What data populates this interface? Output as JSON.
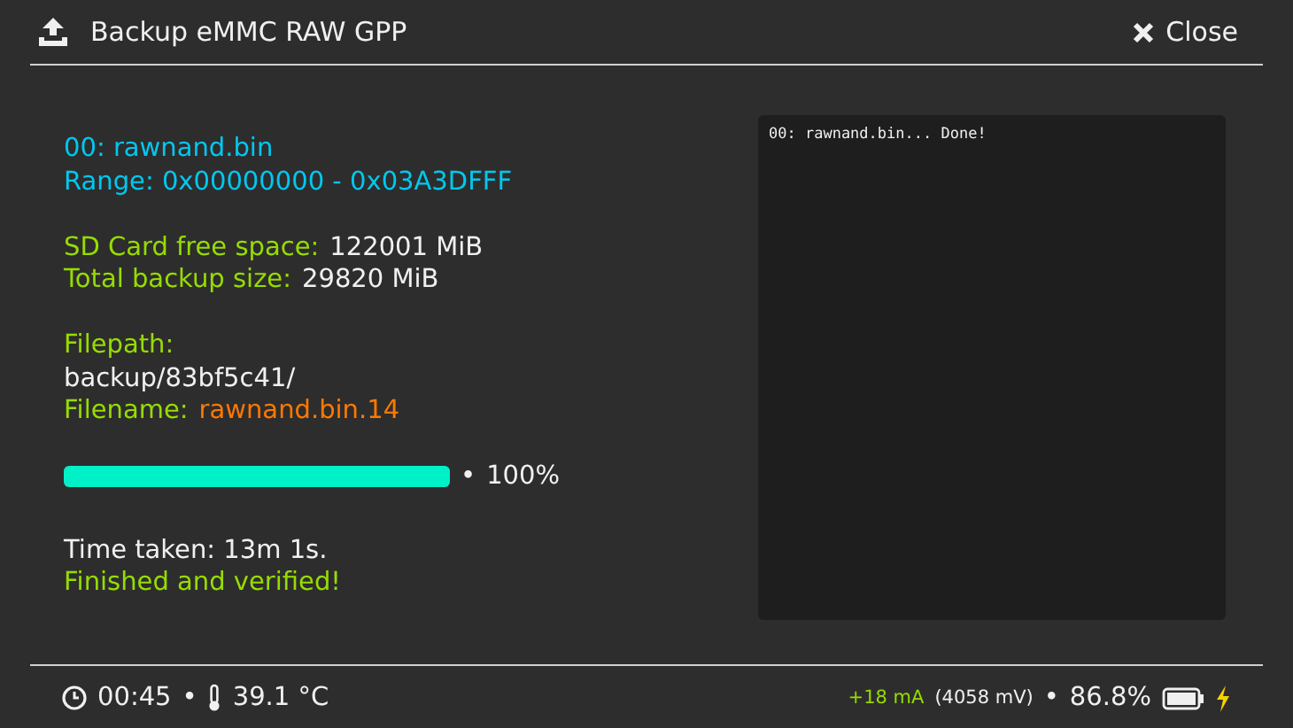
{
  "header": {
    "title": "Backup eMMC RAW GPP",
    "close_label": "Close"
  },
  "info_groups": [
    [
      {
        "parts": [
          {
            "text": "00: rawnand.bin",
            "color": "#00c8ef"
          }
        ]
      },
      {
        "parts": [
          {
            "text": "Range: 0x00000000 - 0x03A3DFFF",
            "color": "#00c8ef"
          }
        ]
      }
    ],
    [
      {
        "parts": [
          {
            "text": "SD Card free space:",
            "color": "#96dc00"
          },
          {
            "text": "122001 MiB",
            "color": "#f0f0f0"
          }
        ]
      },
      {
        "parts": [
          {
            "text": "Total backup size:",
            "color": "#96dc00"
          },
          {
            "text": "29820 MiB",
            "color": "#f0f0f0"
          }
        ]
      }
    ],
    [
      {
        "parts": [
          {
            "text": "Filepath:",
            "color": "#96dc00"
          }
        ]
      },
      {
        "parts": [
          {
            "text": "backup/83bf5c41/",
            "color": "#f0f0f0"
          }
        ]
      },
      {
        "parts": [
          {
            "text": "Filename:",
            "color": "#96dc00"
          },
          {
            "text": "rawnand.bin.14",
            "color": "#ff7800"
          }
        ]
      }
    ]
  ],
  "progress": {
    "level": 1,
    "separator": "•",
    "reading": "100%"
  },
  "result_lines": [
    {
      "text": "Time taken: 13m 1s.",
      "color": "#f0f0f0"
    },
    {
      "text": "Finished and verified!",
      "color": "#96dc00"
    }
  ],
  "console": {
    "lines": [
      "00: rawnand.bin... Done!"
    ]
  },
  "status_bar": {
    "time": "00:45",
    "separator_1": "•",
    "temperature": "39.1 °C",
    "current": "+18 mA",
    "voltage": "(4058 mV)",
    "separator_2": "•",
    "battery": "86.8%",
    "charging": true
  }
}
